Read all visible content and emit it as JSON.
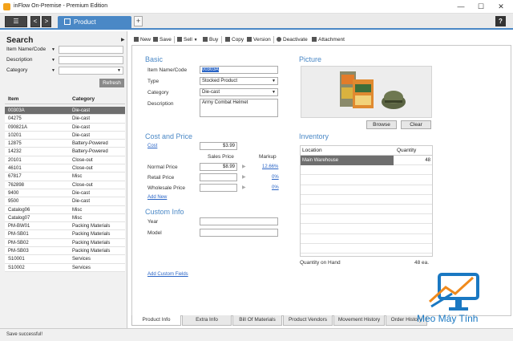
{
  "window": {
    "title": "inFlow On-Premise - Premium Edition",
    "minimize": "—",
    "maximize": "☐",
    "close": "✕"
  },
  "tabs": {
    "menu_glyph": "☰",
    "back_glyph": "<",
    "forward_glyph": ">",
    "active_tab": "Product",
    "add_glyph": "+",
    "help_glyph": "?"
  },
  "search": {
    "title": "Search",
    "collapse_glyph": "▶",
    "filters": [
      {
        "label": "Item Name/Code",
        "dropdown": "▼"
      },
      {
        "label": "Description",
        "dropdown": "▼"
      },
      {
        "label": "Category",
        "dropdown": "▼"
      }
    ],
    "refresh_label": "Refresh",
    "columns": [
      "Item",
      "Category"
    ],
    "rows": [
      {
        "item": "00303A",
        "category": "Die-cast",
        "selected": true
      },
      {
        "item": "04275",
        "category": "Die-cast"
      },
      {
        "item": "090821A",
        "category": "Die-cast"
      },
      {
        "item": "10201",
        "category": "Die-cast"
      },
      {
        "item": "12875",
        "category": "Battery-Powered"
      },
      {
        "item": "14232",
        "category": "Battery-Powered"
      },
      {
        "item": "20101",
        "category": "Close-out"
      },
      {
        "item": "46101",
        "category": "Close-out"
      },
      {
        "item": "67817",
        "category": "Misc"
      },
      {
        "item": "762898",
        "category": "Close-out"
      },
      {
        "item": "9400",
        "category": "Die-cast"
      },
      {
        "item": "9500",
        "category": "Die-cast"
      },
      {
        "item": "Catalog06",
        "category": "Misc"
      },
      {
        "item": "Catalog07",
        "category": "Misc"
      },
      {
        "item": "PM-BW01",
        "category": "Packing Materials"
      },
      {
        "item": "PM-SB01",
        "category": "Packing Materials"
      },
      {
        "item": "PM-SB02",
        "category": "Packing Materials"
      },
      {
        "item": "PM-SB03",
        "category": "Packing Materials"
      },
      {
        "item": "S10001",
        "category": "Services"
      },
      {
        "item": "S10002",
        "category": "Services"
      }
    ]
  },
  "toolbar": {
    "new": "New",
    "save": "Save",
    "sell": "Sell",
    "sell_dropdown": "▼",
    "buy": "Buy",
    "copy": "Copy",
    "version": "Version",
    "deactivate": "Deactivate",
    "attachment": "Attachment"
  },
  "basic": {
    "title": "Basic",
    "item_label": "Item Name/Code",
    "item_value": "00303A",
    "type_label": "Type",
    "type_value": "Stocked Product",
    "category_label": "Category",
    "category_value": "Die-cast",
    "description_label": "Description",
    "description_value": "Army Combat Helmet",
    "dropdown": "▼"
  },
  "cost_price": {
    "title": "Cost and Price",
    "cost_label": "Cost",
    "cost_value": "$3.99",
    "sales_price_header": "Sales Price",
    "markup_header": "Markup",
    "arrow_glyph": "▶",
    "rows": [
      {
        "label": "Normal Price",
        "price": "$8.99",
        "markup": "12.66%"
      },
      {
        "label": "Retail Price",
        "price": "",
        "markup": "0%"
      },
      {
        "label": "Wholesale Price",
        "price": "",
        "markup": "0%"
      }
    ],
    "add_new": "Add New"
  },
  "custom_info": {
    "title": "Custom Info",
    "year_label": "Year",
    "model_label": "Model",
    "add_custom_fields": "Add Custom Fields"
  },
  "picture": {
    "title": "Picture",
    "browse": "Browse",
    "clear": "Clear"
  },
  "inventory": {
    "title": "Inventory",
    "columns": [
      "Location",
      "Quantity"
    ],
    "rows": [
      {
        "location": "Main Warehouse",
        "quantity": "48",
        "selected": true
      },
      {
        "location": "",
        "quantity": ""
      },
      {
        "location": "",
        "quantity": ""
      },
      {
        "location": "",
        "quantity": ""
      },
      {
        "location": "",
        "quantity": ""
      },
      {
        "location": "",
        "quantity": ""
      },
      {
        "location": "",
        "quantity": ""
      },
      {
        "location": "",
        "quantity": ""
      },
      {
        "location": "",
        "quantity": ""
      },
      {
        "location": "",
        "quantity": ""
      }
    ],
    "on_hand_label": "Quantity on Hand",
    "on_hand_value": "48 ea."
  },
  "bottom_tabs": [
    {
      "label": "Product Info",
      "active": true
    },
    {
      "label": "Extra Info"
    },
    {
      "label": "Bill Of Materials"
    },
    {
      "label": "Product Vendors"
    },
    {
      "label": "Movement History"
    },
    {
      "label": "Order History"
    }
  ],
  "status": {
    "text": "Save successful!"
  },
  "watermark": {
    "text": "Meo Máy Tính"
  },
  "colors": {
    "accent": "#4a88c6",
    "selection": "#6e6e6e",
    "link": "#2a65c6"
  }
}
